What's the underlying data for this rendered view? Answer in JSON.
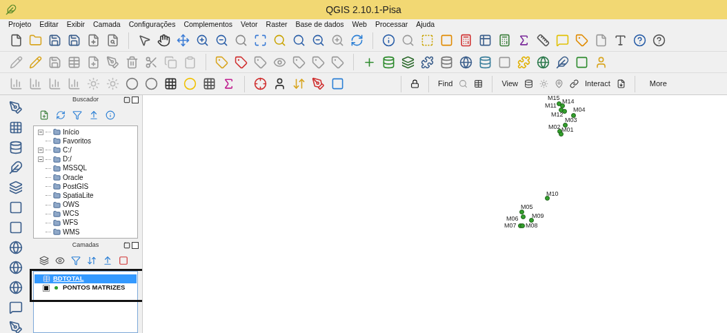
{
  "window": {
    "title": "QGIS 2.10.1-Pisa"
  },
  "menu": [
    "Projeto",
    "Editar",
    "Exibir",
    "Camada",
    "Configurações",
    "Complementos",
    "Vetor",
    "Raster",
    "Base de dados",
    "Web",
    "Processar",
    "Ajuda"
  ],
  "toolbar_labels": [
    {
      "kind": "label",
      "text": "Find"
    },
    {
      "kind": "label",
      "text": "View"
    },
    {
      "kind": "label",
      "text": "Interact"
    },
    {
      "kind": "button",
      "text": "More"
    }
  ],
  "browser": {
    "title": "Buscador",
    "items": [
      {
        "label": "Início",
        "kind": "expandable"
      },
      {
        "label": "Favoritos",
        "kind": "plain"
      },
      {
        "label": "C:/",
        "kind": "expandable"
      },
      {
        "label": "D:/",
        "kind": "expandable"
      },
      {
        "label": "MSSQL",
        "kind": "plain"
      },
      {
        "label": "Oracle",
        "kind": "plain"
      },
      {
        "label": "PostGIS",
        "kind": "plain"
      },
      {
        "label": "SpatiaLite",
        "kind": "plain"
      },
      {
        "label": "OWS",
        "kind": "plain"
      },
      {
        "label": "WCS",
        "kind": "plain"
      },
      {
        "label": "WFS",
        "kind": "plain"
      },
      {
        "label": "WMS",
        "kind": "plain"
      }
    ]
  },
  "layers": {
    "title": "Camadas",
    "items": [
      {
        "label": "BDTOTAL",
        "kind": "group",
        "selected": true
      },
      {
        "label": "PONTOS MATRIZES",
        "kind": "layer",
        "selected": false,
        "checked": true
      }
    ]
  },
  "map": {
    "labels": [
      "M15",
      "M14",
      "M11",
      "M12",
      "M04",
      "M03",
      "M02",
      "M01",
      "M10",
      "M05",
      "M06",
      "M09",
      "M07",
      "M08"
    ]
  }
}
